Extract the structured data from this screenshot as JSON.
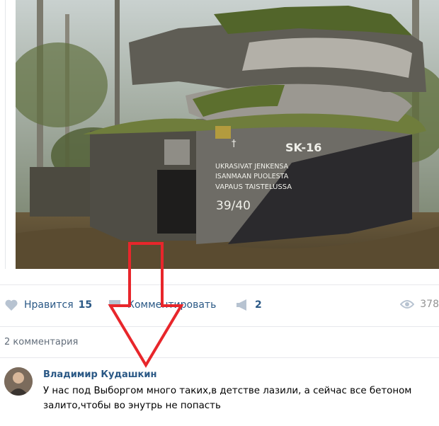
{
  "post": {
    "photo_graffiti": {
      "line1": "UKRASIVAT JENKENSA",
      "line2": "ISANMAAN PUOLESTA",
      "line3": "VAPAUS TAISTELUSSA",
      "code": "SK-16",
      "years": "39/40"
    },
    "actions": {
      "like_label": "Нравится",
      "like_count": "15",
      "comment_label": "Комментировать",
      "share_count": "2",
      "views_count": "378"
    }
  },
  "comments": {
    "count_label": "2 комментария",
    "items": [
      {
        "author": "Владимир Кудашкин",
        "text": "У нас под Выборгом много таких,в детстве лазили, а сейчас все бетоном залито,чтобы во энутрь не попасть"
      }
    ]
  },
  "colors": {
    "link": "#2a5885",
    "arrow": "#e8262b",
    "muted": "#939393"
  }
}
